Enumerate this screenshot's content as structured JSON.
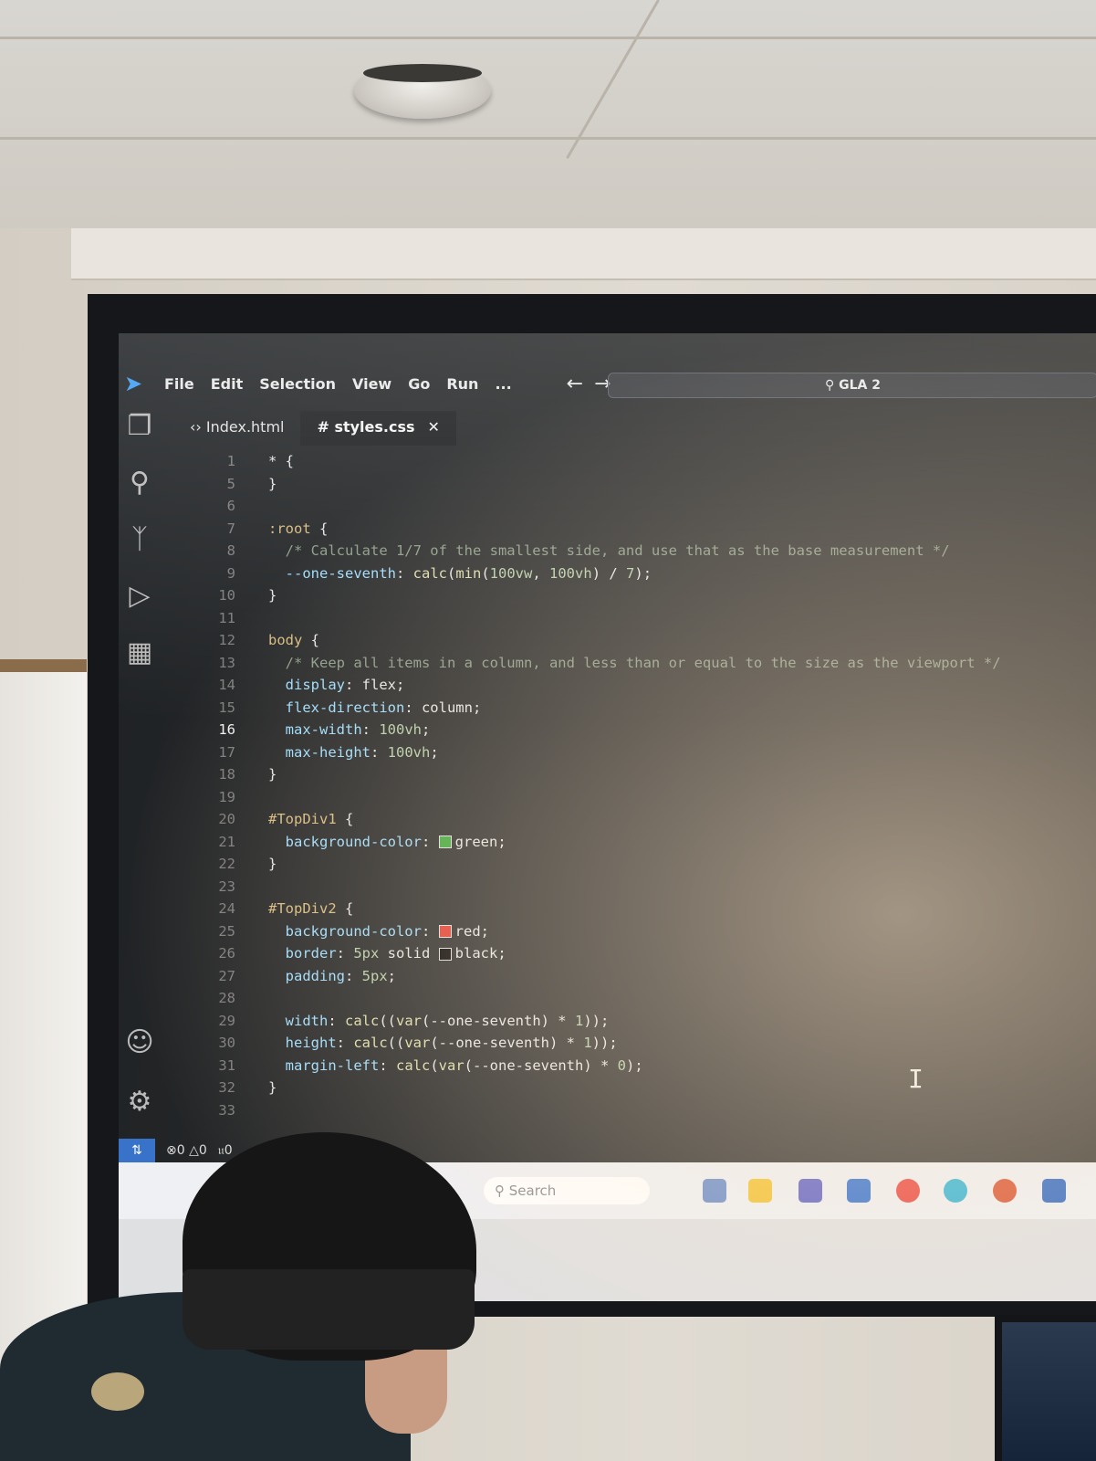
{
  "menu": [
    "File",
    "Edit",
    "Selection",
    "View",
    "Go",
    "Run",
    "..."
  ],
  "search_box": "GLA 2",
  "tabs": [
    {
      "label": "Index.html",
      "active": false
    },
    {
      "label": "styles.css",
      "active": true
    }
  ],
  "code_lines": [
    {
      "n": "1",
      "parts": [
        [
          "code",
          "* {"
        ]
      ]
    },
    {
      "n": "5",
      "parts": [
        [
          "code",
          "}"
        ]
      ]
    },
    {
      "n": "6",
      "parts": []
    },
    {
      "n": "7",
      "parts": [
        [
          "c-sel",
          ":root"
        ],
        [
          "code",
          " {"
        ]
      ]
    },
    {
      "n": "8",
      "parts": [
        [
          "c-com",
          "  /* Calculate 1/7 of the smallest side, and use that as the base measurement */"
        ]
      ]
    },
    {
      "n": "9",
      "parts": [
        [
          "c-prop",
          "  --one-seventh"
        ],
        [
          "code",
          ": "
        ],
        [
          "c-fn",
          "calc"
        ],
        [
          "code",
          "("
        ],
        [
          "c-fn",
          "min"
        ],
        [
          "code",
          "("
        ],
        [
          "c-num",
          "100vw"
        ],
        [
          "code",
          ", "
        ],
        [
          "c-num",
          "100vh"
        ],
        [
          "code",
          ") / "
        ],
        [
          "c-num",
          "7"
        ],
        [
          "code",
          ");"
        ]
      ]
    },
    {
      "n": "10",
      "parts": [
        [
          "code",
          "}"
        ]
      ]
    },
    {
      "n": "11",
      "parts": []
    },
    {
      "n": "12",
      "parts": [
        [
          "c-sel",
          "body"
        ],
        [
          "code",
          " {"
        ]
      ]
    },
    {
      "n": "13",
      "parts": [
        [
          "c-com",
          "  /* Keep all items in a column, and less than or equal to the size as the viewport */"
        ]
      ]
    },
    {
      "n": "14",
      "parts": [
        [
          "c-prop",
          "  display"
        ],
        [
          "code",
          ": flex;"
        ]
      ]
    },
    {
      "n": "15",
      "parts": [
        [
          "c-prop",
          "  flex-direction"
        ],
        [
          "code",
          ": column;"
        ]
      ]
    },
    {
      "n": "16",
      "parts": [
        [
          "c-prop",
          "  max-width"
        ],
        [
          "code",
          ": "
        ],
        [
          "c-num",
          "100vh"
        ],
        [
          "code",
          ";"
        ]
      ],
      "current": true
    },
    {
      "n": "17",
      "parts": [
        [
          "c-prop",
          "  max-height"
        ],
        [
          "code",
          ": "
        ],
        [
          "c-num",
          "100vh"
        ],
        [
          "code",
          ";"
        ]
      ]
    },
    {
      "n": "18",
      "parts": [
        [
          "code",
          "}"
        ]
      ]
    },
    {
      "n": "19",
      "parts": []
    },
    {
      "n": "20",
      "parts": [
        [
          "c-sel",
          "#TopDiv1"
        ],
        [
          "code",
          " {"
        ]
      ]
    },
    {
      "n": "21",
      "parts": [
        [
          "c-prop",
          "  background-color"
        ],
        [
          "code",
          ": "
        ],
        [
          "swatch",
          "#3aa63a"
        ],
        [
          "code",
          "green;"
        ]
      ]
    },
    {
      "n": "22",
      "parts": [
        [
          "code",
          "}"
        ]
      ]
    },
    {
      "n": "23",
      "parts": []
    },
    {
      "n": "24",
      "parts": [
        [
          "c-sel",
          "#TopDiv2"
        ],
        [
          "code",
          " {"
        ]
      ]
    },
    {
      "n": "25",
      "parts": [
        [
          "c-prop",
          "  background-color"
        ],
        [
          "code",
          ": "
        ],
        [
          "swatch",
          "#e03a2f"
        ],
        [
          "code",
          "red;"
        ]
      ]
    },
    {
      "n": "26",
      "parts": [
        [
          "c-prop",
          "  border"
        ],
        [
          "code",
          ": "
        ],
        [
          "c-num",
          "5px"
        ],
        [
          "code",
          " solid "
        ],
        [
          "swatch",
          "#000000"
        ],
        [
          "code",
          "black;"
        ]
      ]
    },
    {
      "n": "27",
      "parts": [
        [
          "c-prop",
          "  padding"
        ],
        [
          "code",
          ": "
        ],
        [
          "c-num",
          "5px"
        ],
        [
          "code",
          ";"
        ]
      ]
    },
    {
      "n": "28",
      "parts": []
    },
    {
      "n": "29",
      "parts": [
        [
          "c-prop",
          "  width"
        ],
        [
          "code",
          ": "
        ],
        [
          "c-fn",
          "calc"
        ],
        [
          "code",
          "(("
        ],
        [
          "c-fn",
          "var"
        ],
        [
          "code",
          "(--one-seventh) * "
        ],
        [
          "c-num",
          "1"
        ],
        [
          "code",
          "));"
        ]
      ]
    },
    {
      "n": "30",
      "parts": [
        [
          "c-prop",
          "  height"
        ],
        [
          "code",
          ": "
        ],
        [
          "c-fn",
          "calc"
        ],
        [
          "code",
          "(("
        ],
        [
          "c-fn",
          "var"
        ],
        [
          "code",
          "(--one-seventh) * "
        ],
        [
          "c-num",
          "1"
        ],
        [
          "code",
          "));"
        ]
      ]
    },
    {
      "n": "31",
      "parts": [
        [
          "c-prop",
          "  margin-left"
        ],
        [
          "code",
          ": "
        ],
        [
          "c-fn",
          "calc"
        ],
        [
          "code",
          "("
        ],
        [
          "c-fn",
          "var"
        ],
        [
          "code",
          "(--one-seventh) * "
        ],
        [
          "c-num",
          "0"
        ],
        [
          "code",
          ");"
        ]
      ]
    },
    {
      "n": "32",
      "parts": [
        [
          "code",
          "}"
        ]
      ]
    },
    {
      "n": "33",
      "parts": []
    }
  ],
  "status": {
    "errors": "0",
    "warnings": "0",
    "ports": "0"
  },
  "taskbar": {
    "search_placeholder": "Search"
  }
}
